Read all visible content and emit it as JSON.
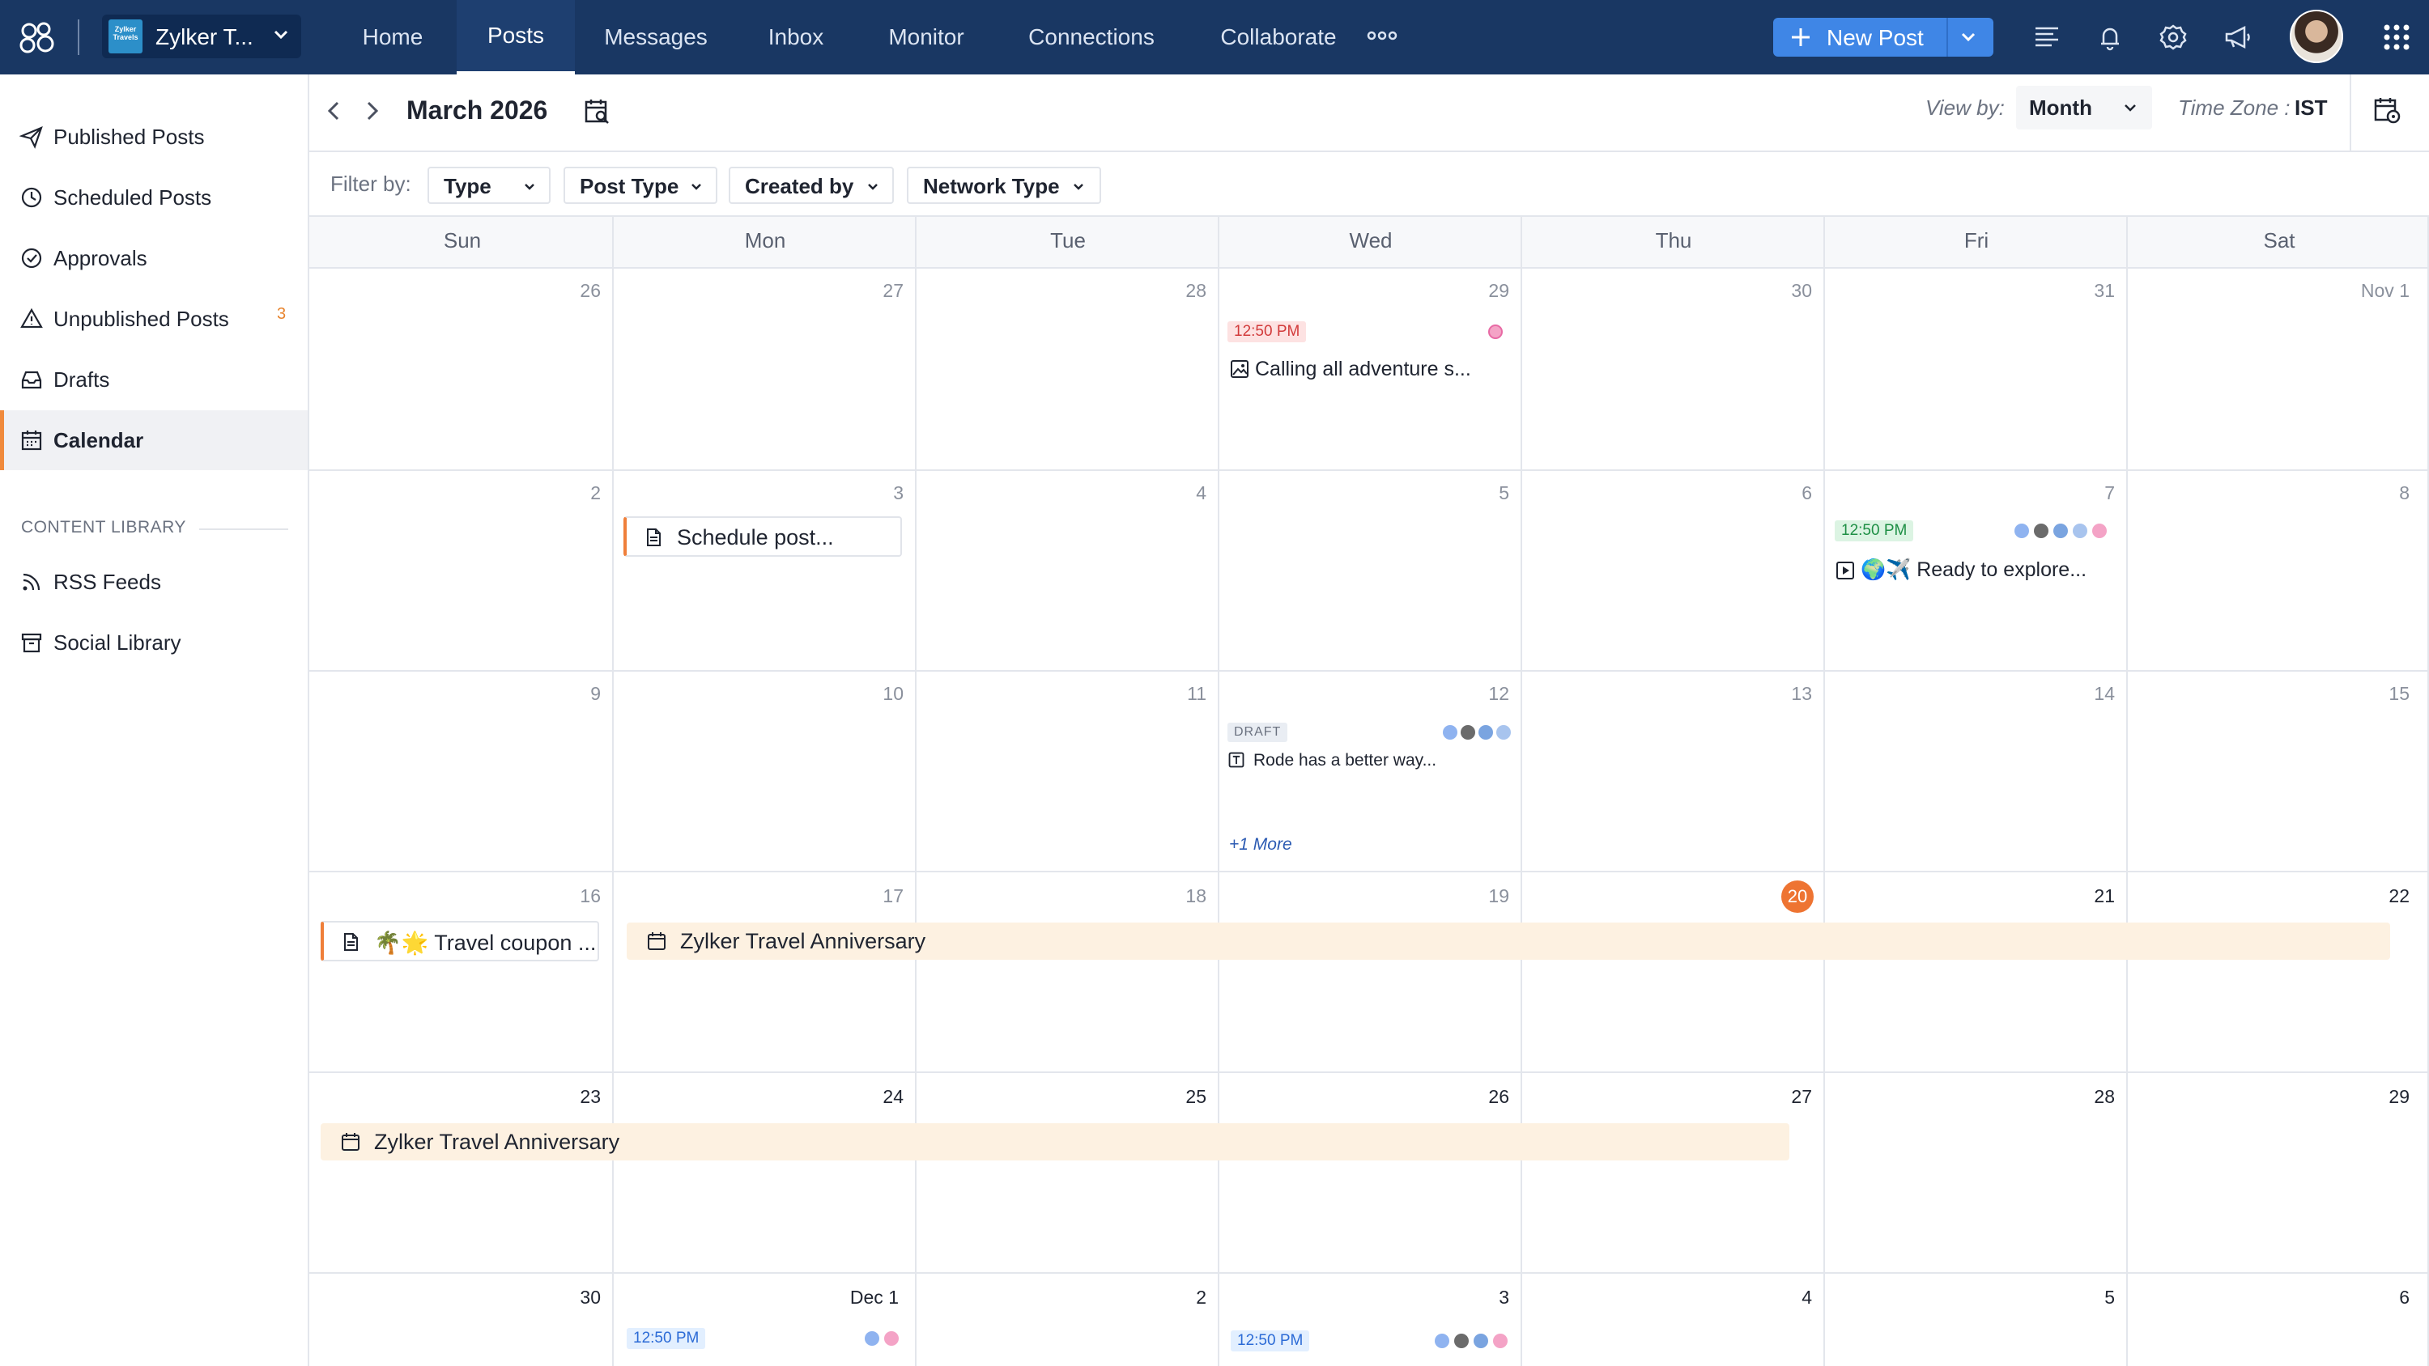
{
  "topbar": {
    "brand_name": "Zylker T...",
    "brand_logo_text": "Zylker Travels",
    "nav": [
      "Home",
      "Posts",
      "Messages",
      "Inbox",
      "Monitor",
      "Connections",
      "Collaborate"
    ],
    "active_nav": "Posts",
    "new_post_label": "New Post"
  },
  "sidebar": {
    "items": [
      {
        "label": "Published Posts",
        "icon": "send-icon"
      },
      {
        "label": "Scheduled Posts",
        "icon": "clock-icon"
      },
      {
        "label": "Approvals",
        "icon": "check-circle-icon"
      },
      {
        "label": "Unpublished Posts",
        "icon": "warning-icon",
        "badge": "3"
      },
      {
        "label": "Drafts",
        "icon": "inbox-tray-icon"
      },
      {
        "label": "Calendar",
        "icon": "calendar-icon",
        "active": true
      }
    ],
    "library_heading": "CONTENT LIBRARY",
    "library_items": [
      {
        "label": "RSS Feeds",
        "icon": "rss-icon"
      },
      {
        "label": "Social Library",
        "icon": "archive-icon"
      }
    ]
  },
  "header": {
    "month_title": "March 2026",
    "view_by_label": "View by:",
    "view_by_value": "Month",
    "time_zone_label": "Time Zone :",
    "time_zone_value": "IST"
  },
  "filters": {
    "label": "Filter by:",
    "buttons": [
      "Type",
      "Post Type",
      "Created by",
      "Network Type"
    ]
  },
  "calendar": {
    "weekdays": [
      "Sun",
      "Mon",
      "Tue",
      "Wed",
      "Thu",
      "Fri",
      "Sat"
    ],
    "weeks": [
      [
        "26",
        "27",
        "28",
        "29",
        "30",
        "31",
        "Nov 1"
      ],
      [
        "2",
        "3",
        "4",
        "5",
        "6",
        "7",
        "8"
      ],
      [
        "9",
        "10",
        "11",
        "12",
        "13",
        "14",
        "15"
      ],
      [
        "16",
        "17",
        "18",
        "19",
        "20",
        "21",
        "22"
      ],
      [
        "23",
        "24",
        "25",
        "26",
        "27",
        "28",
        "29"
      ],
      [
        "30",
        "Dec 1",
        "2",
        "3",
        "4",
        "5",
        "6"
      ]
    ],
    "today": "20",
    "posts": {
      "p1_time": "12:50 PM",
      "p1_text": "Calling all adventure s...",
      "p2_text": "Schedule post...",
      "p3_time": "12:50 PM",
      "p3_text": "🌍✈️ Ready to explore...",
      "p4_status": "DRAFT",
      "p4_text": "Rode has a better way...",
      "p4_more": "+1 More",
      "p5_text": "🌴🌟 Travel coupon ...",
      "event1": "Zylker Travel Anniversary",
      "event2": "Zylker Travel Anniversary",
      "p6_time": "12:50 PM",
      "p7_time": "12:50 PM"
    }
  },
  "colors": {
    "topbar": "#193763",
    "accent": "#3f86e6",
    "today": "#ee7432",
    "event_bg": "#fdf1e1"
  }
}
